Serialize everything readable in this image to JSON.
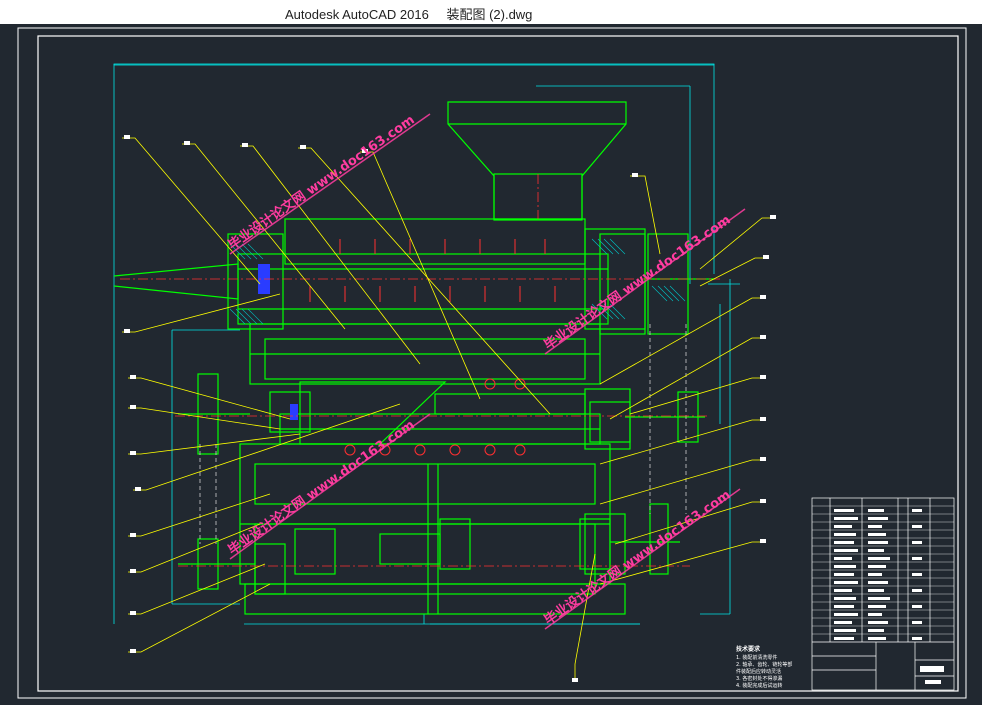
{
  "window": {
    "app_name": "Autodesk AutoCAD 2016",
    "file_name": "装配图 (2).dwg"
  },
  "drawing": {
    "watermark": "毕业设计论文网 www.doc163.com",
    "tech_requirements_title": "技术要求",
    "tech_requirements_lines": [
      "1. 装配前清洗零件",
      "2. 轴承、齿轮、链轮等部",
      "件装配后应转动灵活",
      "3. 各密封处不得渗漏",
      "4. 装配完成后试运转"
    ]
  },
  "colors": {
    "background": "#212830",
    "frame": "#ffffff",
    "outline": "#00ff00",
    "dimension": "#00e5e5",
    "leader": "#ffff00",
    "centerline": "#ff3030",
    "hatch": "#00c0c0",
    "blue": "#2a3cff",
    "watermark": "#ff3ca0"
  }
}
